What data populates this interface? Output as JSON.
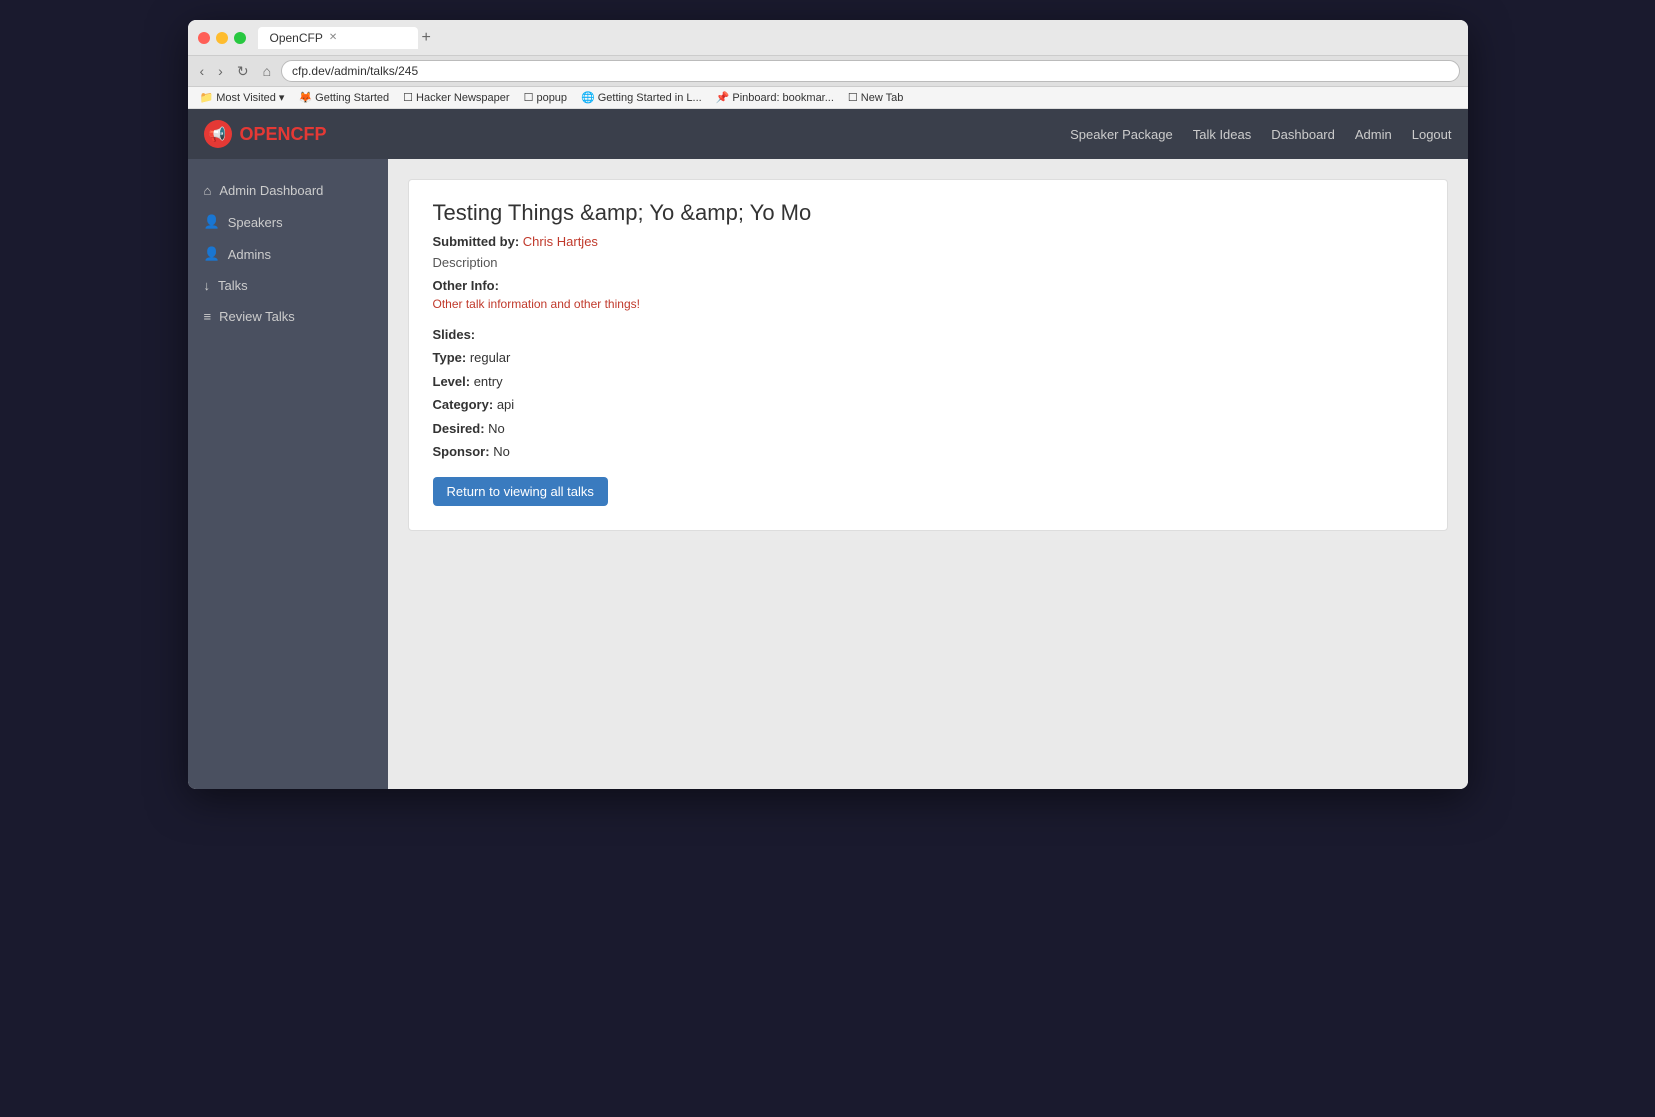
{
  "browser": {
    "tab_title": "OpenCFP",
    "url": "cfp.dev/admin/talks/245",
    "new_tab_symbol": "+"
  },
  "bookmarks": [
    {
      "label": "Most Visited",
      "has_arrow": true
    },
    {
      "label": "Getting Started"
    },
    {
      "label": "Hacker Newspaper"
    },
    {
      "label": "popup"
    },
    {
      "label": "Getting Started in L..."
    },
    {
      "label": "Pinboard: bookmar..."
    },
    {
      "label": "New Tab"
    }
  ],
  "topnav": {
    "logo_open": "OPEN",
    "logo_cfp": "CFP",
    "logo_icon": "📢",
    "links": [
      {
        "label": "Speaker Package"
      },
      {
        "label": "Talk Ideas"
      },
      {
        "label": "Dashboard"
      },
      {
        "label": "Admin"
      },
      {
        "label": "Logout"
      }
    ]
  },
  "sidebar": {
    "items": [
      {
        "icon": "⌂",
        "label": "Admin Dashboard"
      },
      {
        "icon": "👤",
        "label": "Speakers"
      },
      {
        "icon": "👤",
        "label": "Admins"
      },
      {
        "icon": "↓",
        "label": "Talks"
      },
      {
        "icon": "≡",
        "label": "Review Talks"
      }
    ]
  },
  "talk": {
    "title": "Testing Things &amp; Yo &amp; Yo Mo",
    "submitted_by_label": "Submitted by:",
    "author_name": "Chris Hartjes",
    "description_label": "Description",
    "other_info_label": "Other Info:",
    "other_info_text": "Other talk information and other things!",
    "slides_label": "Slides:",
    "slides_value": "",
    "type_label": "Type:",
    "type_value": "regular",
    "level_label": "Level:",
    "level_value": "entry",
    "category_label": "Category:",
    "category_value": "api",
    "desired_label": "Desired:",
    "desired_value": "No",
    "sponsor_label": "Sponsor:",
    "sponsor_value": "No",
    "return_btn_label": "Return to viewing all talks"
  }
}
